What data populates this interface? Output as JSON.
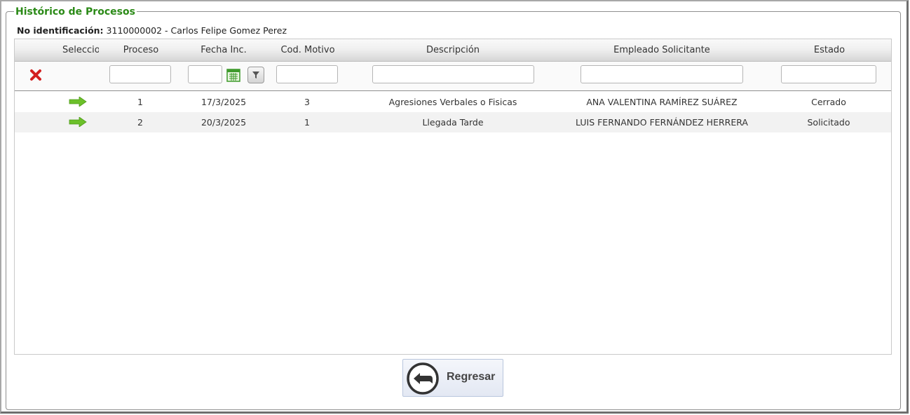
{
  "panel": {
    "title": "Histórico de Procesos",
    "ident_label": "No identificación:",
    "ident_value": "3110000002 - Carlos Felipe Gomez Perez"
  },
  "grid": {
    "columns": [
      "Seleccior",
      "Proceso",
      "Fecha Inc.",
      "Cod. Motivo",
      "Descripción",
      "Empleado Solicitante",
      "Estado"
    ],
    "rows": [
      {
        "proceso": "1",
        "fecha": "17/3/2025",
        "cod": "3",
        "descripcion": "Agresiones Verbales o Fisicas",
        "empleado": "ANA VALENTINA RAMÍREZ SUÁREZ",
        "estado": "Cerrado"
      },
      {
        "proceso": "2",
        "fecha": "20/3/2025",
        "cod": "1",
        "descripcion": "Llegada Tarde",
        "empleado": "LUIS FERNANDO FERNÁNDEZ HERRERA",
        "estado": "Solicitado"
      }
    ],
    "icons": {
      "clear": "clear-filter-icon",
      "calendar": "calendar-icon",
      "filter": "filter-icon",
      "select": "arrow-right-icon"
    }
  },
  "actions": {
    "back_label": "Regresar",
    "back_icon": "back-arrow-icon"
  },
  "colors": {
    "title": "#2b8a17",
    "arrow": "#6cc02a",
    "clear": "#d32020"
  }
}
